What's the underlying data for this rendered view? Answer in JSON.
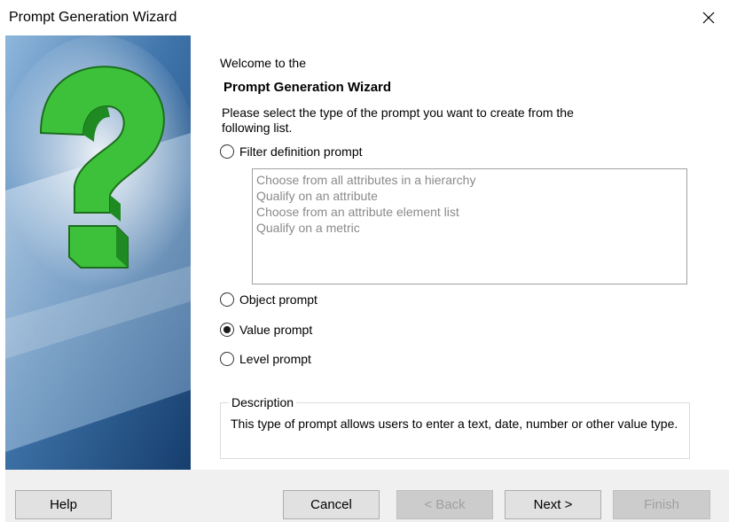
{
  "window": {
    "title": "Prompt Generation Wizard"
  },
  "intro": {
    "welcome": "Welcome to the",
    "wizard_name": "Prompt Generation Wizard",
    "instructions": "Please select the type of the prompt you want to create from the following list."
  },
  "prompt_types": [
    {
      "label": "Filter definition prompt",
      "selected": false
    },
    {
      "label": "Object prompt",
      "selected": false
    },
    {
      "label": "Value prompt",
      "selected": true
    },
    {
      "label": "Level prompt",
      "selected": false
    }
  ],
  "filter_options": [
    "Choose from all attributes in a hierarchy",
    "Qualify on an attribute",
    "Choose from an attribute element list",
    "Qualify on a metric"
  ],
  "description": {
    "legend": "Description",
    "text": "This type of prompt allows users to enter a text, date, number or other value type."
  },
  "buttons": {
    "help": "Help",
    "cancel": "Cancel",
    "back": "< Back",
    "next": "Next >",
    "finish": "Finish"
  },
  "icons": {
    "close": "close-icon",
    "banner": "question-mark-icon"
  },
  "colors": {
    "banner_green": "#39c53a",
    "banner_blue": "#2a5f95",
    "footer_bg": "#f0f0f0"
  }
}
